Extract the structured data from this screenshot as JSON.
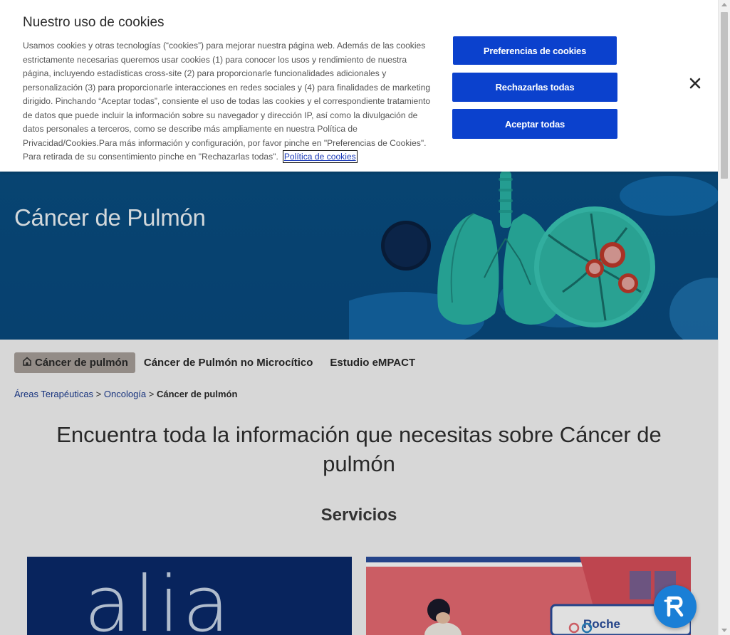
{
  "cookie": {
    "title": "Nuestro uso de cookies",
    "body": "Usamos cookies y otras tecnologías (“cookies”) para mejorar nuestra página web. Además de las cookies estrictamente necesarias queremos usar cookies (1) para conocer los usos y rendimiento de nuestra página, incluyendo estadísticas cross-site (2) para proporcionarle funcionalidades adicionales y personalización (3) para proporcionarle interacciones en redes sociales y (4) para finalidades de marketing dirigido. Pinchando “Aceptar todas”, consiente el uso de todas las cookies y el correspondiente tratamiento de datos que puede incluir la información sobre su navegador y dirección IP, así como la divulgación de datos personales a terceros, como se describe más ampliamente en nuestra Política de Privacidad/Cookies.Para más información y configuración, por favor pinche en \"Preferencias de Cookies\". Para retirada de su consentimiento pinche en \"Rechazarlas todas\".",
    "policy_link": "Política de cookies",
    "preferences_button": "Preferencias de cookies",
    "reject_button": "Rechazarlas todas",
    "accept_button": "Aceptar todas",
    "close_icon": "close-icon"
  },
  "hero": {
    "title": "Cáncer de Pulmón"
  },
  "nav": {
    "tabs": [
      {
        "label": "Cáncer de pulmón",
        "active": true,
        "icon": "home-icon"
      },
      {
        "label": "Cáncer de Pulmón no Microcítico",
        "active": false
      },
      {
        "label": "Estudio eMPACT",
        "active": false
      }
    ]
  },
  "breadcrumb": {
    "items": [
      "Áreas Terapéuticas",
      "Oncología"
    ],
    "separator": ">",
    "current": "Cáncer de pulmón"
  },
  "main": {
    "heading": "Encuentra toda la información que necesitas sobre Cáncer de pulmón",
    "services_heading": "Servicios"
  },
  "cards": {
    "alia_logo_text": "alia",
    "illus_logo_text": "Roche"
  },
  "colors": {
    "primary_button": "#0b41cd",
    "hero_bg": "#0a4f82",
    "alia_bg": "#0a2a6a",
    "assistant_bg": "#1a7fd6"
  }
}
